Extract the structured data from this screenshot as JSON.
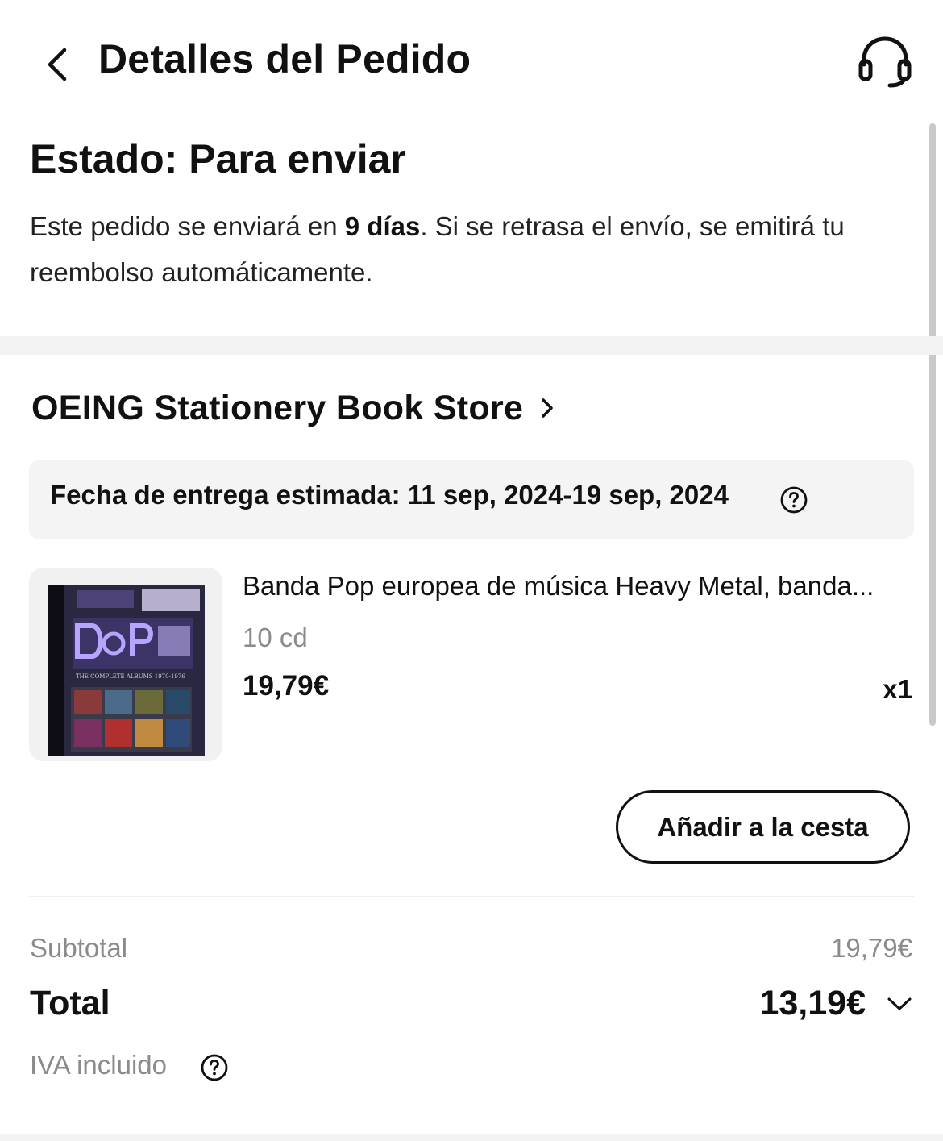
{
  "header": {
    "title": "Detalles del Pedido",
    "back_icon": "chevron-left-icon",
    "support_icon": "headset-icon"
  },
  "status": {
    "title": "Estado: Para enviar",
    "desc_before": "Este pedido se enviará en ",
    "desc_bold": "9 días",
    "desc_after": ". Si se retrasa el envío, se emitirá tu reembolso automáticamente."
  },
  "store": {
    "name": "OEING Stationery Book Store",
    "chevron_icon": "chevron-right-icon"
  },
  "delivery": {
    "text": "Fecha de entrega estimada: 11 sep, 2024-19 sep, 2024",
    "help_icon": "question-circle-icon"
  },
  "product": {
    "name": "Banda Pop europea de música Heavy Metal, banda...",
    "variant": "10 cd",
    "price": "19,79€",
    "quantity": "x1",
    "image_caption": "THE COMPLETE ALBUMS 1970-1976"
  },
  "actions": {
    "add_to_cart": "Añadir a la cesta"
  },
  "summary": {
    "subtotal_label": "Subtotal",
    "subtotal_value": "19,79€",
    "total_label": "Total",
    "total_value": "13,19€",
    "expand_icon": "chevron-down-icon",
    "vat_label": "IVA incluido",
    "vat_help_icon": "question-circle-icon"
  },
  "colors": {
    "text_primary": "#111111",
    "text_secondary": "#8b8b8b",
    "panel_background": "#f4f4f4",
    "section_band": "#f3f3f3"
  }
}
